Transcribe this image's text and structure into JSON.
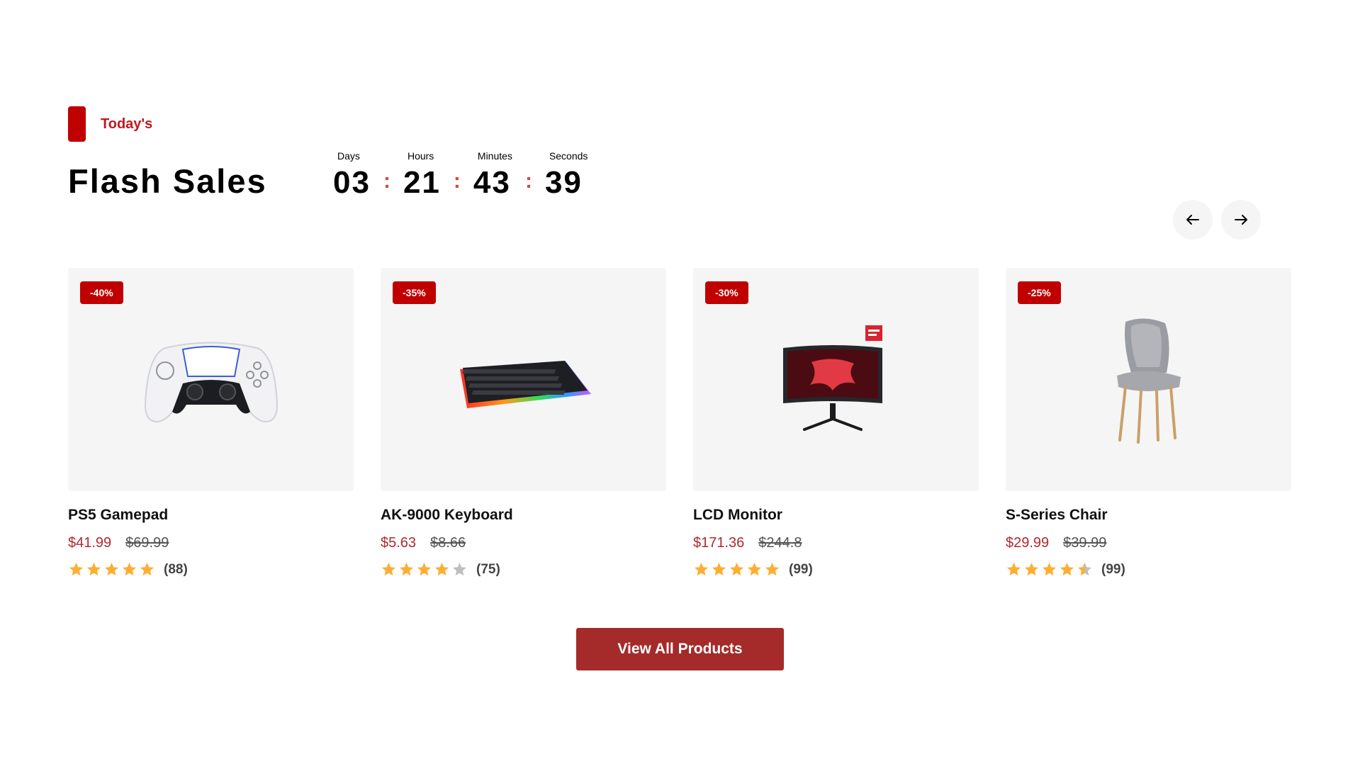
{
  "section": {
    "tag": "Today's",
    "title": "Flash Sales"
  },
  "countdown": [
    {
      "label": "Days",
      "value": "03"
    },
    {
      "label": "Hours",
      "value": "21"
    },
    {
      "label": "Minutes",
      "value": "43"
    },
    {
      "label": "Seconds",
      "value": "39"
    }
  ],
  "countdown_separator": ":",
  "colors": {
    "accent": "#c00000",
    "price": "#b3282d",
    "button": "#a52a2a",
    "star": "#ffad33",
    "star_empty": "#bfbfbf",
    "card_bg": "#f5f5f5"
  },
  "nav": {
    "prev_icon": "arrow-left-icon",
    "next_icon": "arrow-right-icon"
  },
  "products": [
    {
      "name": "PS5 Gamepad",
      "discount": "-40%",
      "price": "$41.99",
      "old_price": "$69.99",
      "rating": 5,
      "reviews": "(88)",
      "image_icon": "gamepad-image"
    },
    {
      "name": "AK-9000 Keyboard",
      "discount": "-35%",
      "price": "$5.63",
      "old_price": "$8.66",
      "rating": 4,
      "reviews": "(75)",
      "image_icon": "keyboard-image"
    },
    {
      "name": "LCD Monitor",
      "discount": "-30%",
      "price": "$171.36",
      "old_price": "$244.8",
      "rating": 5,
      "reviews": "(99)",
      "image_icon": "monitor-image"
    },
    {
      "name": "S-Series Chair",
      "discount": "-25%",
      "price": "$29.99",
      "old_price": "$39.99",
      "rating": 4.5,
      "reviews": "(99)",
      "image_icon": "chair-image"
    }
  ],
  "view_all_label": "View All Products"
}
